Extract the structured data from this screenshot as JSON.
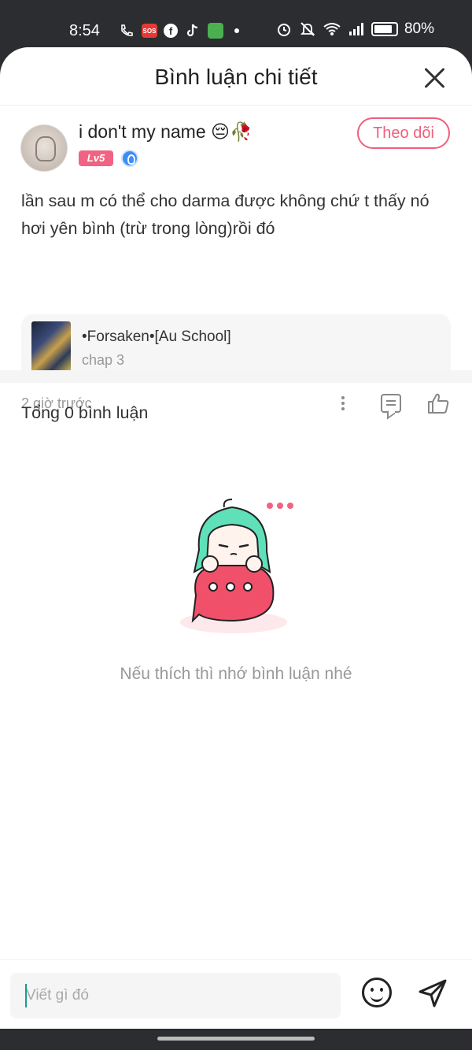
{
  "status_bar": {
    "time": "8:54",
    "battery_percent": "80%",
    "icons": [
      "phone-wifi-call-icon",
      "sos-icon",
      "facebook-icon",
      "tiktok-icon",
      "messages-icon",
      "dot-icon",
      "alarm-icon",
      "mute-icon",
      "wifi-icon",
      "signal-icon",
      "battery-icon"
    ]
  },
  "header": {
    "title": "Bình luận chi tiết",
    "close_icon": "close-icon"
  },
  "comment": {
    "username": "i don't my name 😔🥀",
    "level": "Lv5",
    "follow_label": "Theo dõi",
    "text": "lần sau m có thể cho darma được không chứ t thấy nó hơi yên bình (trừ trong lòng)rồi đó",
    "chapter": {
      "title": "•Forsaken•[Au School]",
      "subtitle": "chap 3"
    },
    "time": "2 giờ trước",
    "actions": [
      "more-icon",
      "reply-icon",
      "like-icon"
    ]
  },
  "replies": {
    "total_label": "Tổng 0 bình luận",
    "empty_text": "Nếu thích thì nhớ bình luận nhé"
  },
  "input_bar": {
    "placeholder": "Viết gì đó",
    "value": ""
  },
  "colors": {
    "accent": "#ef5f7c",
    "level_badge": "#f06383",
    "verify": "#3d8ef5",
    "mascot_hair": "#5fe0b8",
    "mascot_bubble": "#f0506a"
  }
}
